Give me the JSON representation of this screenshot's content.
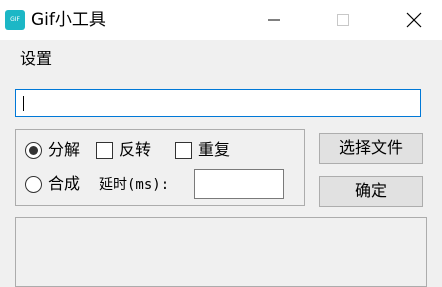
{
  "window": {
    "app_icon": "gif-app-icon",
    "app_icon_text": "GIF",
    "title": "Gif小工具",
    "minimize_icon": "minimize-icon",
    "maximize_icon": "maximize-icon",
    "close_icon": "close-icon"
  },
  "menu": {
    "items": [
      {
        "label": "设置"
      }
    ]
  },
  "form": {
    "path_value": "",
    "options": {
      "split_label": "分解",
      "split_selected": true,
      "reverse_label": "反转",
      "reverse_checked": false,
      "repeat_label": "重复",
      "repeat_checked": false,
      "combine_label": "合成",
      "combine_selected": false,
      "delay_label": "延时(ms):",
      "delay_value": ""
    },
    "select_file_label": "选择文件",
    "confirm_label": "确定",
    "output_text": ""
  },
  "colors": {
    "accent": "#0078d7",
    "app_icon": "#1cb7c6",
    "window_bg": "#f0f0f0"
  }
}
